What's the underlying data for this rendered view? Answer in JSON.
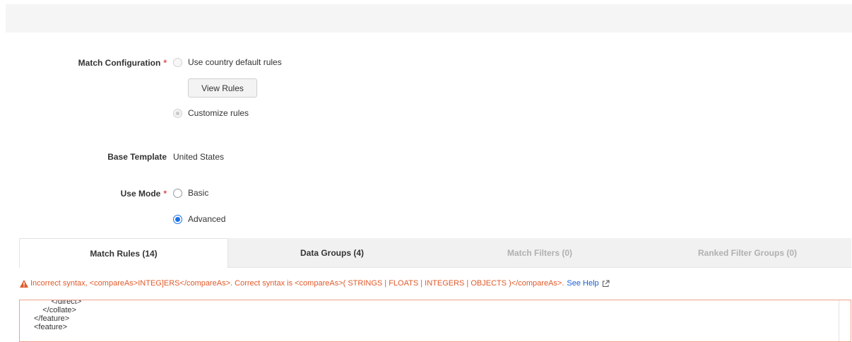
{
  "form": {
    "match_config": {
      "label": "Match Configuration",
      "required_mark": "*",
      "option_default": "Use country default rules",
      "view_rules": "View Rules",
      "option_custom": "Customize rules"
    },
    "base_template": {
      "label": "Base Template",
      "value": "United States"
    },
    "use_mode": {
      "label": "Use Mode",
      "required_mark": "*",
      "option_basic": "Basic",
      "option_advanced": "Advanced"
    }
  },
  "tabs": [
    {
      "label": "Match Rules (14)",
      "state": "active"
    },
    {
      "label": "Data Groups (4)",
      "state": "normal"
    },
    {
      "label": "Match Filters (0)",
      "state": "disabled"
    },
    {
      "label": "Ranked Filter Groups (0)",
      "state": "disabled"
    }
  ],
  "error": {
    "message": "Incorrect syntax, <compareAs>INTEG]ERS</compareAs>. Correct syntax is <compareAs>( STRINGS | FLOATS | INTEGERS | OBJECTS )</compareAs>.",
    "help_link": "See Help",
    "icon": "warning-icon"
  },
  "editor": {
    "lines": [
      "        </direct>",
      "    </collate>",
      "</feature>",
      "<feature>"
    ]
  },
  "colors": {
    "required": "#e24a4a",
    "error": "#e05a2b",
    "link": "#1a5fd1",
    "accent": "#1a73e8"
  }
}
